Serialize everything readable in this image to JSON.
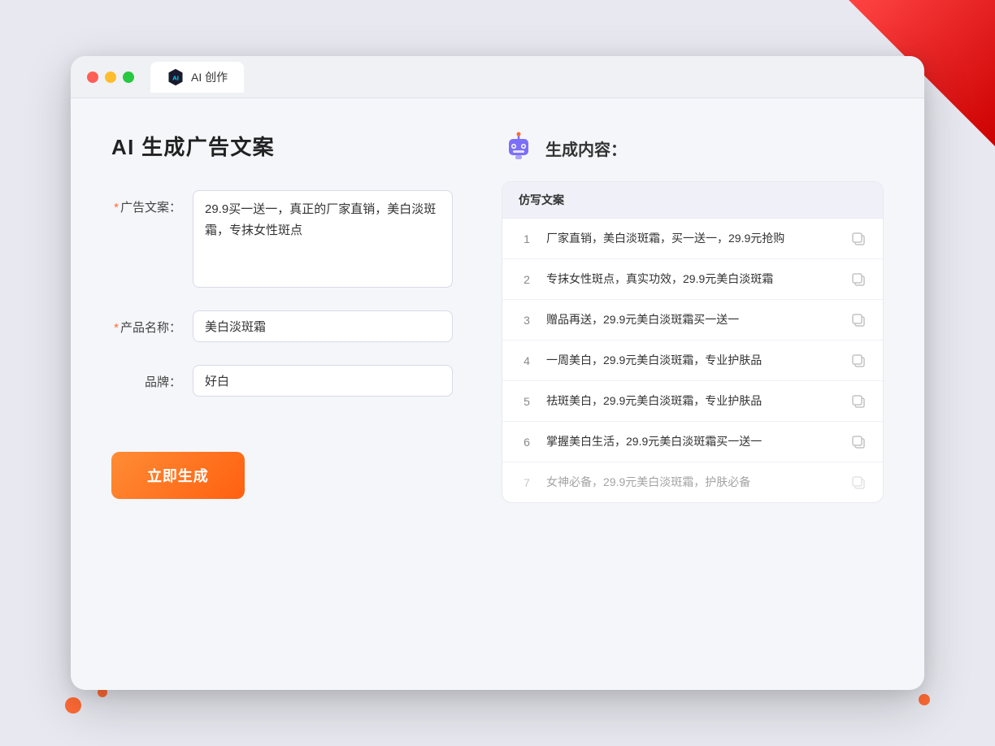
{
  "window": {
    "tab_label": "AI 创作"
  },
  "page": {
    "title": "AI 生成广告文案",
    "generate_button": "立即生成"
  },
  "form": {
    "ad_copy_label": "广告文案：",
    "ad_copy_required": "*",
    "ad_copy_value": "29.9买一送一，真正的厂家直销，美白淡斑霜，专抹女性斑点",
    "product_name_label": "产品名称：",
    "product_name_required": "*",
    "product_name_value": "美白淡斑霜",
    "brand_label": "品牌：",
    "brand_value": "好白"
  },
  "result": {
    "header": "生成内容：",
    "column_label": "仿写文案",
    "items": [
      {
        "number": "1",
        "text": "厂家直销，美白淡斑霜，买一送一，29.9元抢购",
        "dimmed": false
      },
      {
        "number": "2",
        "text": "专抹女性斑点，真实功效，29.9元美白淡斑霜",
        "dimmed": false
      },
      {
        "number": "3",
        "text": "赠品再送，29.9元美白淡斑霜买一送一",
        "dimmed": false
      },
      {
        "number": "4",
        "text": "一周美白，29.9元美白淡斑霜，专业护肤品",
        "dimmed": false
      },
      {
        "number": "5",
        "text": "祛斑美白，29.9元美白淡斑霜，专业护肤品",
        "dimmed": false
      },
      {
        "number": "6",
        "text": "掌握美白生活，29.9元美白淡斑霜买一送一",
        "dimmed": false
      },
      {
        "number": "7",
        "text": "女神必备，29.9元美白淡斑霜，护肤必备",
        "dimmed": true
      }
    ]
  },
  "colors": {
    "accent_orange": "#ff6b35",
    "accent_blue": "#6b7ff0",
    "required_star": "#ff6b35"
  }
}
